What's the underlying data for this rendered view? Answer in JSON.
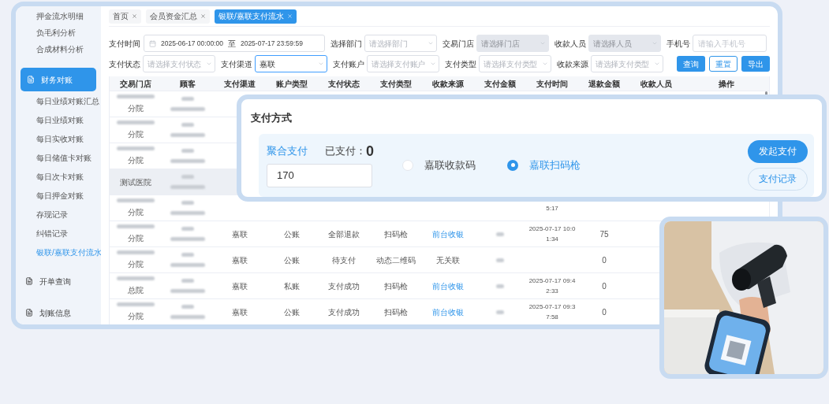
{
  "sidebar": {
    "items": [
      {
        "label": "押金流水明细",
        "kind": "link",
        "selected": false
      },
      {
        "label": "负毛利分析",
        "kind": "link",
        "selected": false
      },
      {
        "label": "合成材料分析",
        "kind": "link",
        "selected": false
      },
      {
        "label": "财务对账",
        "kind": "group",
        "selected": true,
        "children": [
          {
            "label": "每日业绩对账汇总",
            "selected": false
          },
          {
            "label": "每日业绩对账",
            "selected": false
          },
          {
            "label": "每日实收对账",
            "selected": false
          },
          {
            "label": "每日储值卡对账",
            "selected": false
          },
          {
            "label": "每日次卡对账",
            "selected": false
          },
          {
            "label": "每日押金对账",
            "selected": false
          },
          {
            "label": "存现记录",
            "selected": false
          },
          {
            "label": "纠错记录",
            "selected": false
          },
          {
            "label": "银联/嘉联支付流水",
            "selected": true
          }
        ]
      },
      {
        "label": "开单查询",
        "kind": "group",
        "selected": false
      },
      {
        "label": "划账信息",
        "kind": "group",
        "selected": false
      }
    ]
  },
  "tabs": [
    {
      "label": "首页",
      "selected": false
    },
    {
      "label": "会员资金汇总",
      "selected": false
    },
    {
      "label": "银联/嘉联支付流水",
      "selected": true
    }
  ],
  "filters": {
    "fields": [
      {
        "label": "支付时间",
        "kind": "date-range",
        "start": "2025-06-17 00:00:00",
        "separator": "至",
        "end": "2025-07-17 23:59:59"
      },
      {
        "label": "选择部门",
        "kind": "select",
        "placeholder": "请选择部门",
        "disabled": false,
        "focused": false
      },
      {
        "label": "交易门店",
        "kind": "select",
        "placeholder": "请选择门店",
        "disabled": true,
        "focused": false
      },
      {
        "label": "收款人员",
        "kind": "select",
        "placeholder": "请选择人员",
        "disabled": true,
        "focused": false
      },
      {
        "label": "手机号",
        "kind": "input",
        "placeholder": "请输入手机号"
      },
      {
        "label": "支付状态",
        "kind": "select",
        "placeholder": "请选择支付状态",
        "disabled": false,
        "focused": false
      },
      {
        "label": "支付渠道",
        "kind": "select",
        "value": "嘉联",
        "disabled": false,
        "focused": true
      },
      {
        "label": "支付账户",
        "kind": "select",
        "placeholder": "请选择支付账户",
        "disabled": false,
        "focused": false
      },
      {
        "label": "支付类型",
        "kind": "select",
        "placeholder": "请选择支付类型",
        "disabled": false,
        "focused": false
      },
      {
        "label": "收款来源",
        "kind": "select",
        "placeholder": "请选择支付类型",
        "disabled": false,
        "focused": false
      }
    ],
    "buttons": [
      {
        "label": "查询",
        "kind": "primary"
      },
      {
        "label": "重置",
        "kind": "outline"
      },
      {
        "label": "导出",
        "kind": "primary"
      }
    ]
  },
  "table": {
    "columns": [
      "交易门店",
      "顾客",
      "支付渠道",
      "账户类型",
      "支付状态",
      "支付类型",
      "收款来源",
      "支付金额",
      "支付时间",
      "退款金额",
      "收款人员",
      "操作"
    ],
    "rows": [
      {
        "kind": "branch",
        "store": "分院",
        "hovered": false
      },
      {
        "kind": "branch",
        "store": "分院",
        "hovered": false
      },
      {
        "kind": "branch",
        "store": "分院",
        "hovered": false
      },
      {
        "kind": "named",
        "store": "测试医院",
        "hovered": true
      },
      {
        "kind": "branch",
        "store": "分院",
        "pay_time": "5:17",
        "hovered": false
      },
      {
        "kind": "branch",
        "store": "分院",
        "channel": "嘉联",
        "account_type": "公账",
        "status": "全部退款",
        "pay_type": "扫码枪",
        "source": {
          "text": "前台收银",
          "link": true
        },
        "pay_time": "2025-07-17 10:01:34",
        "refund": "75",
        "hovered": false
      },
      {
        "kind": "branch",
        "store": "分院",
        "channel": "嘉联",
        "account_type": "公账",
        "status": "待支付",
        "pay_type": "动态二维码",
        "source": {
          "text": "无关联",
          "link": false
        },
        "refund": "0",
        "hovered": false
      },
      {
        "kind": "branch",
        "store": "总院",
        "channel": "嘉联",
        "account_type": "私账",
        "status": "支付成功",
        "pay_type": "扫码枪",
        "source": {
          "text": "前台收银",
          "link": true
        },
        "pay_time": "2025-07-17 09:42:33",
        "refund": "0",
        "hovered": false
      },
      {
        "kind": "branch",
        "store": "分院",
        "channel": "嘉联",
        "account_type": "公账",
        "status": "支付成功",
        "pay_type": "扫码枪",
        "source": {
          "text": "前台收银",
          "link": true
        },
        "pay_time": "2025-07-17 09:37:58",
        "refund": "0",
        "hovered": false
      }
    ]
  },
  "payment_dialog": {
    "title": "支付方式",
    "mode": "聚合支付",
    "paid_label": "已支付：",
    "paid_value": "0",
    "amount": "170",
    "options": [
      {
        "label": "嘉联收款码",
        "selected": false
      },
      {
        "label": "嘉联扫码枪",
        "selected": true
      }
    ],
    "buttons": [
      {
        "label": "发起支付",
        "kind": "primary"
      },
      {
        "label": "支付记录",
        "kind": "outline"
      }
    ]
  }
}
